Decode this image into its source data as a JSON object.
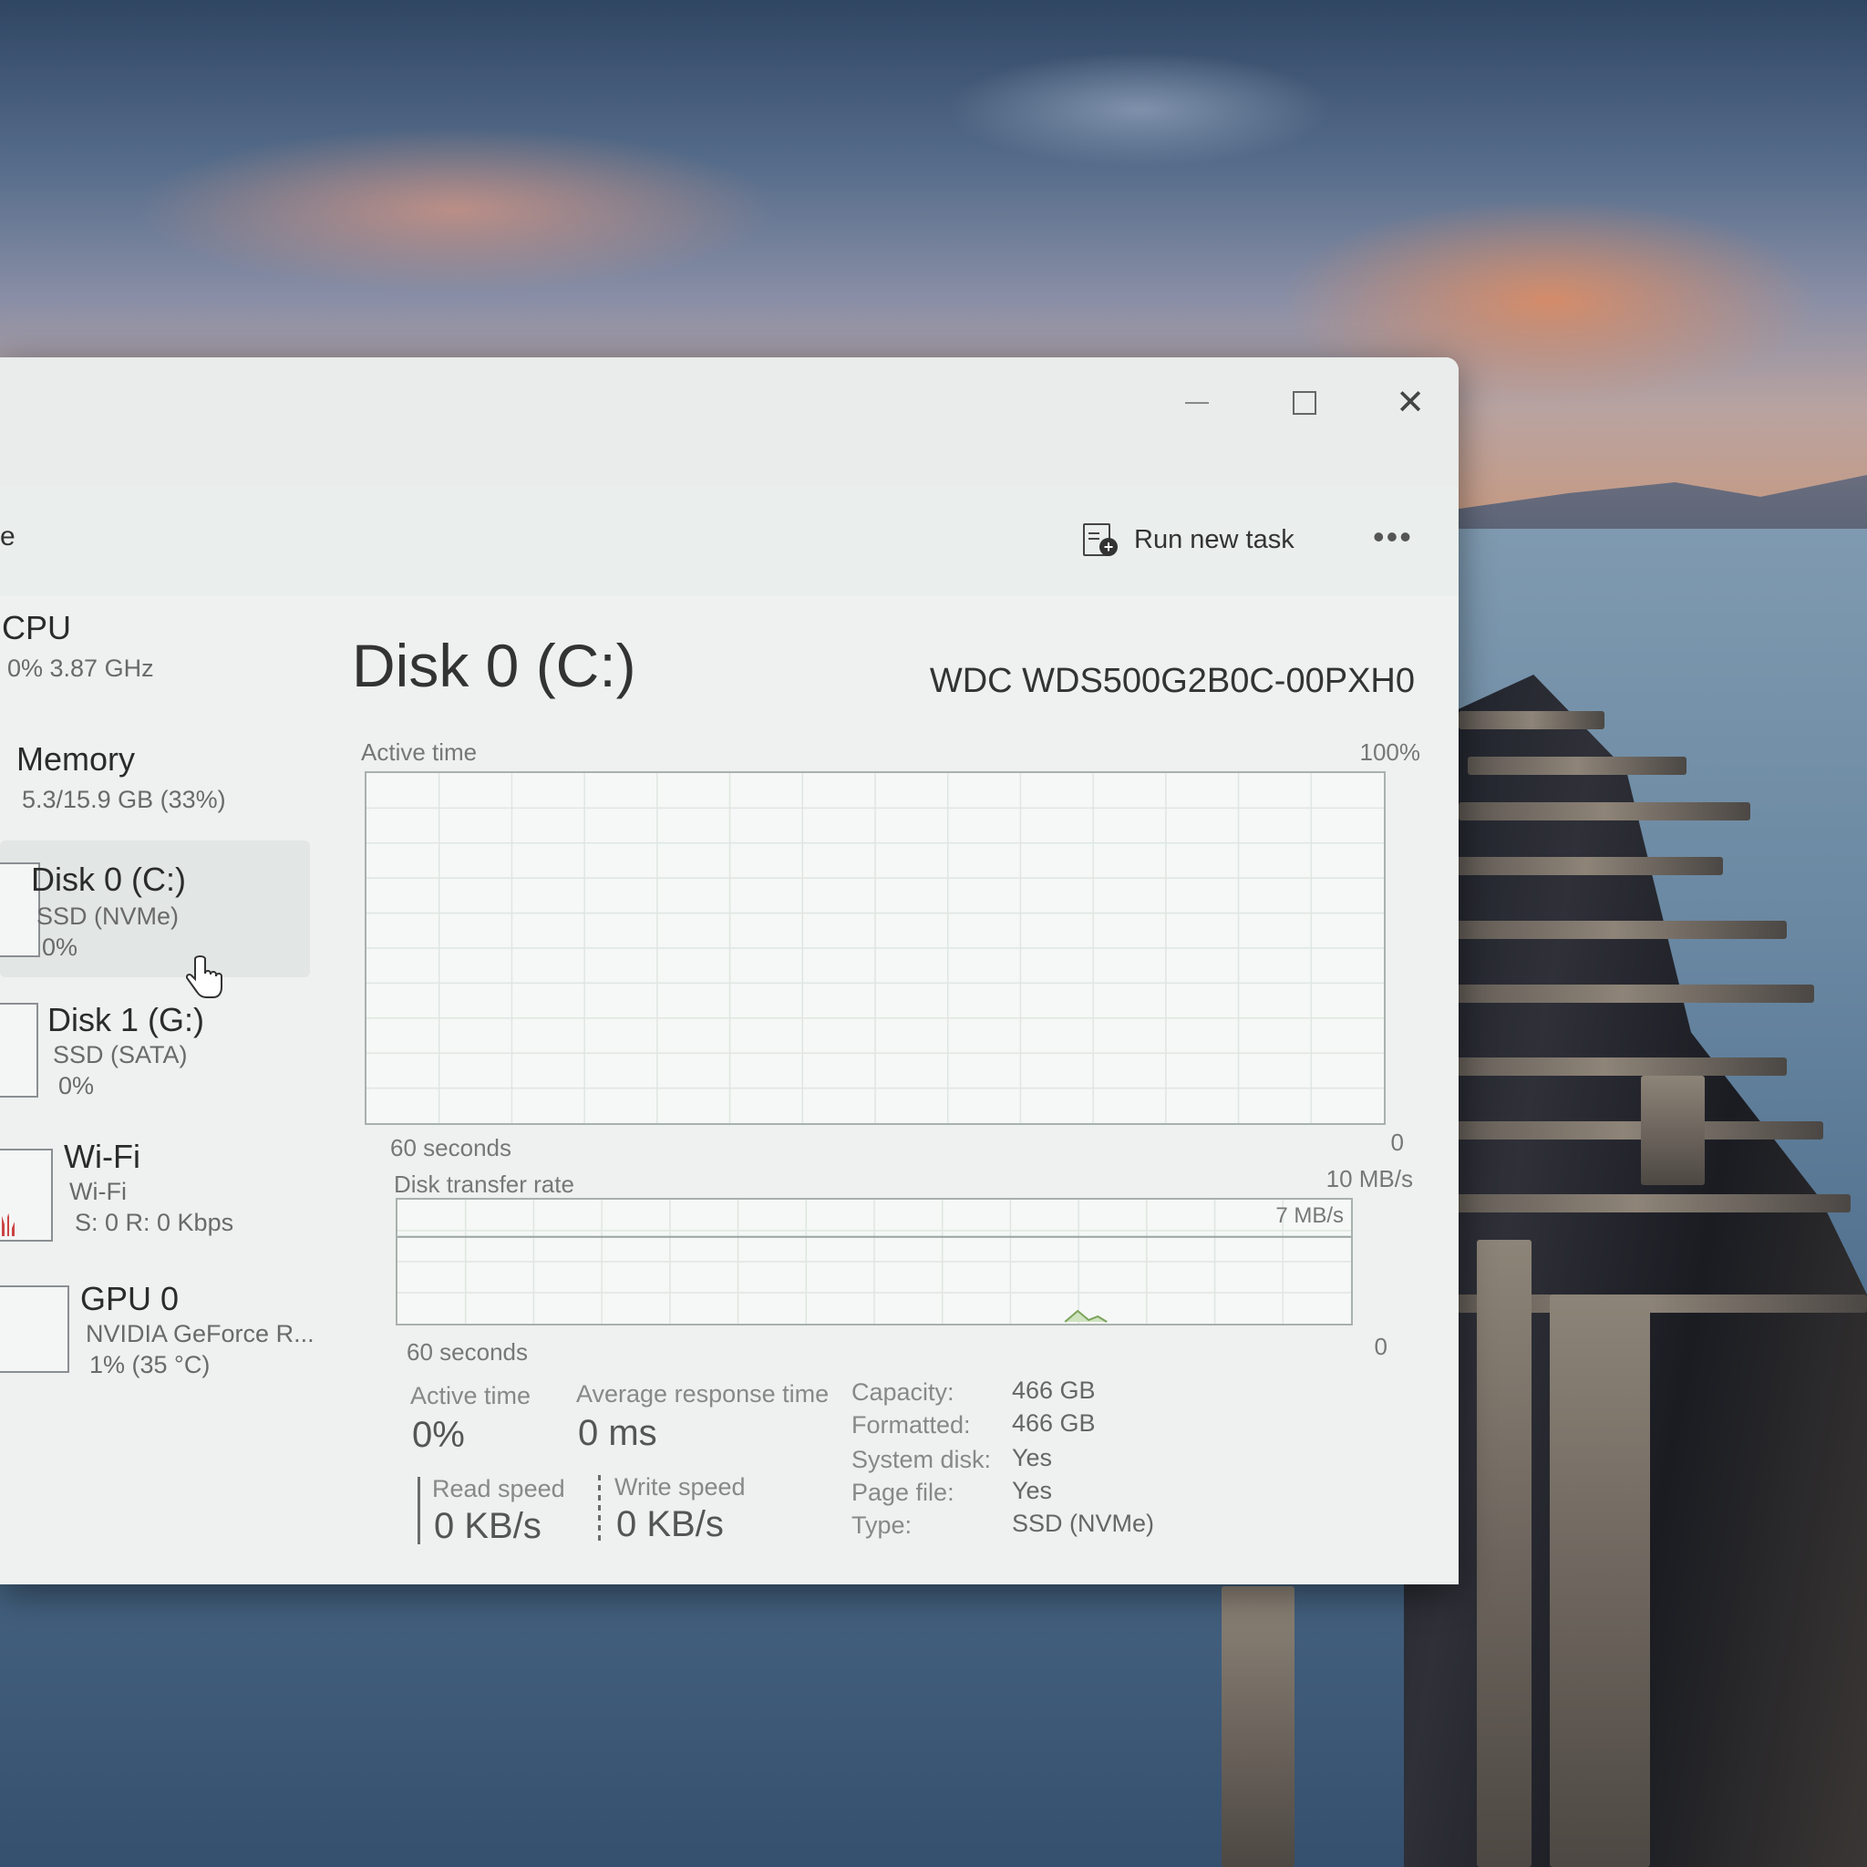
{
  "window": {
    "title_stub": "e",
    "run_new_task": "Run new task",
    "more_label": "•••"
  },
  "sidebar": {
    "items": [
      {
        "name": "CPU",
        "line1": "0% 3.87 GHz"
      },
      {
        "name": "Memory",
        "line1": "5.3/15.9 GB (33%)"
      },
      {
        "name": "Disk 0 (C:)",
        "line1": "SSD (NVMe)",
        "line2": "0%"
      },
      {
        "name": "Disk 1 (G:)",
        "line1": "SSD (SATA)",
        "line2": "0%"
      },
      {
        "name": "Wi-Fi",
        "line1": "Wi-Fi",
        "line2": "S: 0 R: 0 Kbps"
      },
      {
        "name": "GPU 0",
        "line1": "NVIDIA GeForce R...",
        "line2": "1% (35 °C)"
      }
    ]
  },
  "main": {
    "title": "Disk 0 (C:)",
    "model": "WDC WDS500G2B0C-00PXH0",
    "active_graph": {
      "label": "Active time",
      "max": "100%",
      "time_label": "60 seconds",
      "min": "0"
    },
    "transfer_graph": {
      "label": "Disk transfer rate",
      "max": "10 MB/s",
      "mid": "7 MB/s",
      "time_label": "60 seconds",
      "min": "0"
    },
    "stats": {
      "active_time_label": "Active time",
      "active_time_value": "0%",
      "response_label": "Average response time",
      "response_value": "0 ms",
      "read_label": "Read speed",
      "read_value": "0 KB/s",
      "write_label": "Write speed",
      "write_value": "0 KB/s"
    },
    "info": [
      {
        "key": "Capacity:",
        "value": "466 GB"
      },
      {
        "key": "Formatted:",
        "value": "466 GB"
      },
      {
        "key": "System disk:",
        "value": "Yes"
      },
      {
        "key": "Page file:",
        "value": "Yes"
      },
      {
        "key": "Type:",
        "value": "SSD (NVMe)"
      }
    ]
  },
  "colors": {
    "window_bg": "#eef1ef",
    "graph_border": "#a9b1ad",
    "graph_grid": "#dfe6e2",
    "transfer_line": "#7aa35a"
  }
}
